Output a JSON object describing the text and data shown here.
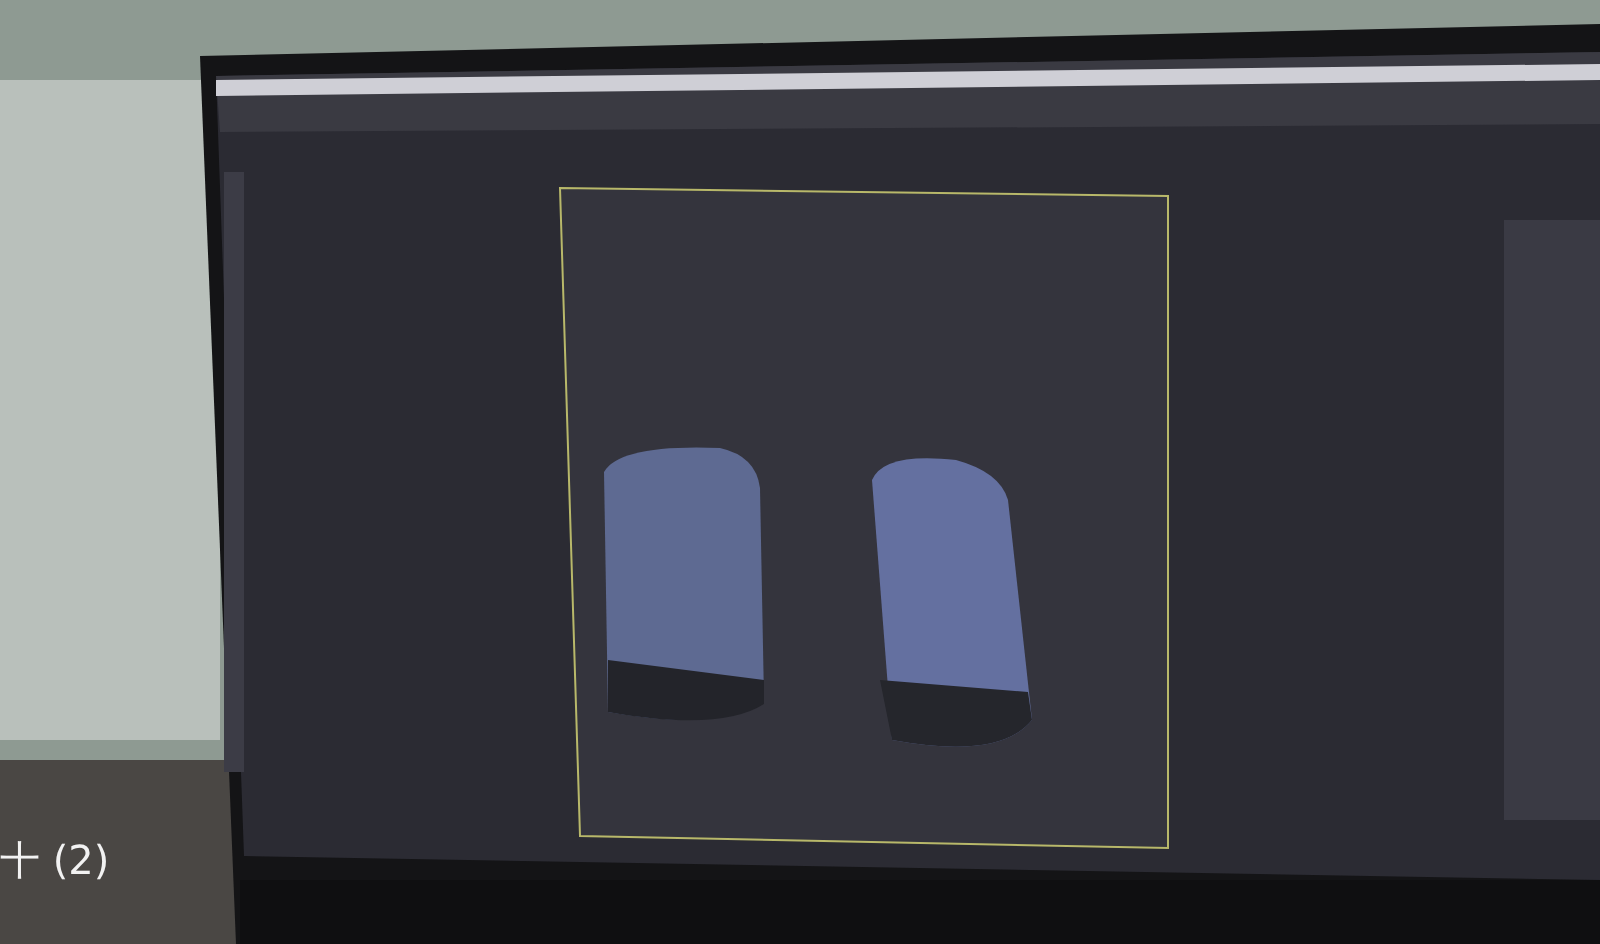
{
  "caption": {
    "text": "十 (2)"
  }
}
